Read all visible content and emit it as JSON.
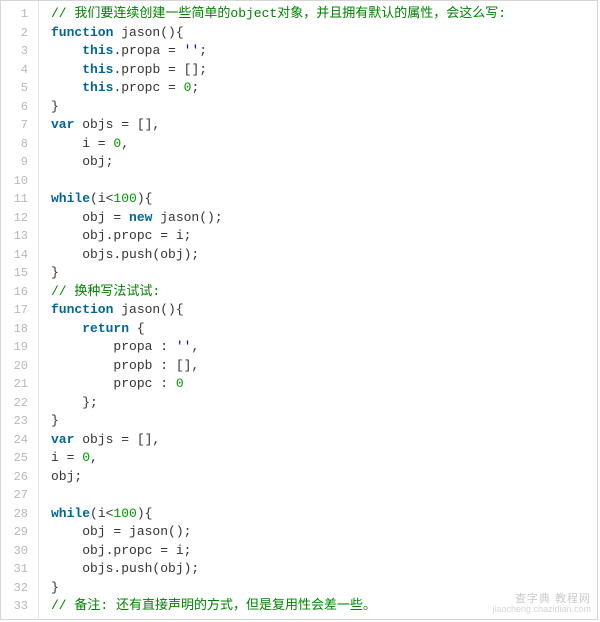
{
  "lineCount": 33,
  "lines": [
    [
      [
        "comment",
        "// 我们要连续创建一些简单的object对象，并且拥有默认的属性，会这么写:"
      ]
    ],
    [
      [
        "kw",
        "function"
      ],
      [
        "plain",
        " jason(){"
      ]
    ],
    [
      [
        "plain",
        "    "
      ],
      [
        "kw",
        "this"
      ],
      [
        "plain",
        ".propa = "
      ],
      [
        "str",
        "''"
      ],
      [
        "plain",
        ";"
      ]
    ],
    [
      [
        "plain",
        "    "
      ],
      [
        "kw",
        "this"
      ],
      [
        "plain",
        ".propb = [];"
      ]
    ],
    [
      [
        "plain",
        "    "
      ],
      [
        "kw",
        "this"
      ],
      [
        "plain",
        ".propc = "
      ],
      [
        "num",
        "0"
      ],
      [
        "plain",
        ";"
      ]
    ],
    [
      [
        "plain",
        "}"
      ]
    ],
    [
      [
        "kw",
        "var"
      ],
      [
        "plain",
        " objs = [],"
      ]
    ],
    [
      [
        "plain",
        "    i = "
      ],
      [
        "num",
        "0"
      ],
      [
        "plain",
        ","
      ]
    ],
    [
      [
        "plain",
        "    obj;"
      ]
    ],
    [
      [
        "plain",
        " "
      ]
    ],
    [
      [
        "kw",
        "while"
      ],
      [
        "plain",
        "(i<"
      ],
      [
        "num",
        "100"
      ],
      [
        "plain",
        "){"
      ]
    ],
    [
      [
        "plain",
        "    obj = "
      ],
      [
        "kw",
        "new"
      ],
      [
        "plain",
        " jason();"
      ]
    ],
    [
      [
        "plain",
        "    obj.propc = i;"
      ]
    ],
    [
      [
        "plain",
        "    objs.push(obj);"
      ]
    ],
    [
      [
        "plain",
        "}"
      ]
    ],
    [
      [
        "comment",
        "// 换种写法试试:"
      ]
    ],
    [
      [
        "kw",
        "function"
      ],
      [
        "plain",
        " jason(){"
      ]
    ],
    [
      [
        "plain",
        "    "
      ],
      [
        "kw",
        "return"
      ],
      [
        "plain",
        " {"
      ]
    ],
    [
      [
        "plain",
        "        propa : "
      ],
      [
        "str",
        "''"
      ],
      [
        "plain",
        ","
      ]
    ],
    [
      [
        "plain",
        "        propb : [],"
      ]
    ],
    [
      [
        "plain",
        "        propc : "
      ],
      [
        "num",
        "0"
      ]
    ],
    [
      [
        "plain",
        "    };"
      ]
    ],
    [
      [
        "plain",
        "}"
      ]
    ],
    [
      [
        "kw",
        "var"
      ],
      [
        "plain",
        " objs = [],"
      ]
    ],
    [
      [
        "plain",
        "i = "
      ],
      [
        "num",
        "0"
      ],
      [
        "plain",
        ","
      ]
    ],
    [
      [
        "plain",
        "obj;"
      ]
    ],
    [
      [
        "plain",
        " "
      ]
    ],
    [
      [
        "kw",
        "while"
      ],
      [
        "plain",
        "(i<"
      ],
      [
        "num",
        "100"
      ],
      [
        "plain",
        "){"
      ]
    ],
    [
      [
        "plain",
        "    obj = jason();"
      ]
    ],
    [
      [
        "plain",
        "    obj.propc = i;"
      ]
    ],
    [
      [
        "plain",
        "    objs.push(obj);"
      ]
    ],
    [
      [
        "plain",
        "}"
      ]
    ],
    [
      [
        "comment",
        "// 备注: 还有直接声明的方式，但是复用性会差一些。"
      ]
    ]
  ],
  "watermark": {
    "line1": "查字典 教程网",
    "line2": "jiaocheng.chazidian.com"
  }
}
